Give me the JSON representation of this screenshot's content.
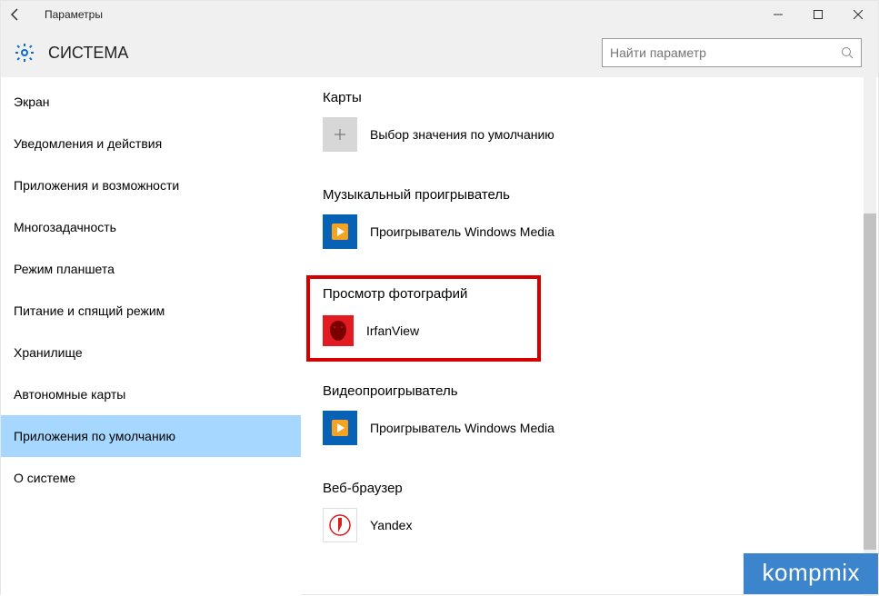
{
  "titlebar": {
    "title": "Параметры"
  },
  "header": {
    "section": "СИСТЕМА"
  },
  "search": {
    "placeholder": "Найти параметр"
  },
  "sidebar": {
    "items": [
      {
        "label": "Экран"
      },
      {
        "label": "Уведомления и действия"
      },
      {
        "label": "Приложения и возможности"
      },
      {
        "label": "Многозадачность"
      },
      {
        "label": "Режим планшета"
      },
      {
        "label": "Питание и спящий режим"
      },
      {
        "label": "Хранилище"
      },
      {
        "label": "Автономные карты"
      },
      {
        "label": "Приложения по умолчанию"
      },
      {
        "label": "О системе"
      }
    ],
    "selected_index": 8
  },
  "main": {
    "groups": [
      {
        "title": "Карты",
        "app": "Выбор значения по умолчанию",
        "icon": "plus"
      },
      {
        "title": "Музыкальный проигрыватель",
        "app": "Проигрыватель Windows Media",
        "icon": "wmp"
      },
      {
        "title": "Просмотр фотографий",
        "app": "IrfanView",
        "icon": "irfan",
        "highlighted": true
      },
      {
        "title": "Видеопроигрыватель",
        "app": "Проигрыватель Windows Media",
        "icon": "wmp"
      },
      {
        "title": "Веб-браузер",
        "app": "Yandex",
        "icon": "yandex"
      }
    ]
  },
  "watermark": "kompmix"
}
